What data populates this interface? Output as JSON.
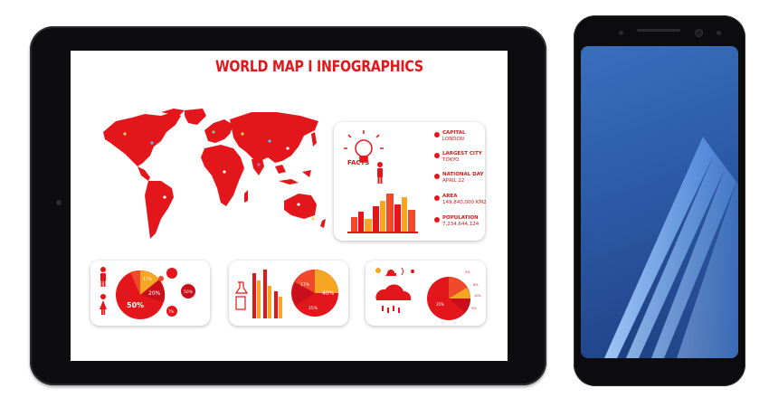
{
  "infographic": {
    "title": "WORLD MAP I INFOGRAPHICS",
    "facts_badge": "FACTS",
    "facts": [
      {
        "label": "CAPITAL",
        "value": "LONDON"
      },
      {
        "label": "LARGEST CITY",
        "value": "TOKYO"
      },
      {
        "label": "NATIONAL DAY",
        "value": "APRIL 22"
      },
      {
        "label": "AREA",
        "value": "149,840,000 KM2"
      },
      {
        "label": "POPULATION",
        "value": "7,234,644,124"
      }
    ],
    "card1": {
      "pie_labels": [
        "50%",
        "17%",
        "20%"
      ],
      "bubbles": [
        "50%",
        "20%",
        "7%",
        "5%"
      ]
    },
    "card2": {
      "pie_labels": [
        "40%",
        "17%",
        "25%"
      ],
      "bar_count": 5
    },
    "card3": {
      "pie_labels": [
        "35%",
        "5%",
        "8%",
        "10%",
        "5%"
      ]
    }
  },
  "colors": {
    "accent": "#e3171b",
    "orange": "#f5a623",
    "phone_wallpaper": "#2c5aa6"
  },
  "icons": [
    "lightbulb-icon",
    "person-icon",
    "cityscape-icon",
    "cloud-icon",
    "weather-icons"
  ]
}
